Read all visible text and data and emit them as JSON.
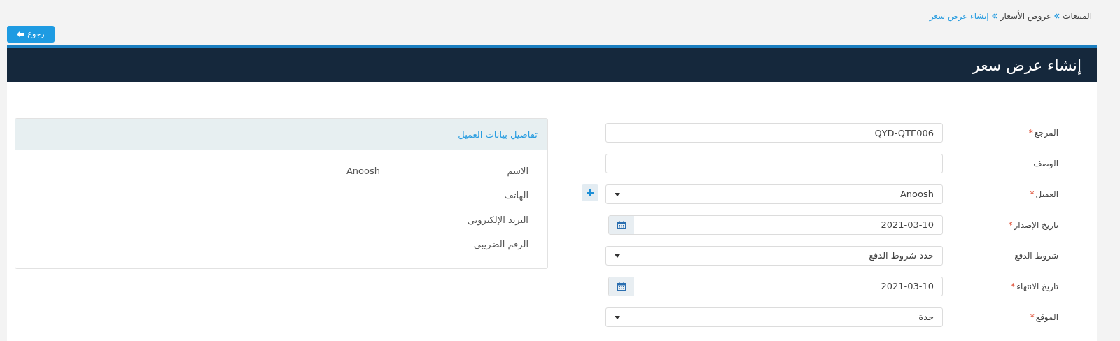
{
  "breadcrumb": [
    {
      "label": "المبيعات",
      "current": false
    },
    {
      "label": "عروض الأسعار",
      "current": false
    },
    {
      "label": "إنشاء عرض سعر",
      "current": true
    }
  ],
  "back_button": {
    "label": "رجوع"
  },
  "panel": {
    "title": "إنشاء عرض سعر"
  },
  "form": [
    {
      "label": "المرجع",
      "required_mark": "*",
      "kind": "text",
      "value": "QYD-QTE006"
    },
    {
      "label": "الوصف",
      "kind": "text"
    },
    {
      "label": "العميل",
      "required_mark": "*",
      "kind": "select",
      "value": "Anoosh",
      "add_button": true
    },
    {
      "label": "تاريخ الإصدار",
      "required_mark": "*",
      "kind": "date",
      "value": "2021-03-10"
    },
    {
      "label": "شروط الدفع",
      "kind": "select",
      "value": "حدد شروط الدفع"
    },
    {
      "label": "تاريخ الانتهاء",
      "required_mark": "*",
      "kind": "date",
      "value": "2021-03-10"
    },
    {
      "label": "الموقع",
      "required_mark": "*",
      "kind": "select",
      "value": "جدة"
    }
  ],
  "customer_card": {
    "title": "تفاصيل بيانات العميل",
    "rows": [
      {
        "label": "الاسم",
        "value": "Anoosh"
      },
      {
        "label": "الهاتف"
      },
      {
        "label": "البريد الإلكتروني"
      },
      {
        "label": "الرقم الضريبي"
      }
    ]
  }
}
